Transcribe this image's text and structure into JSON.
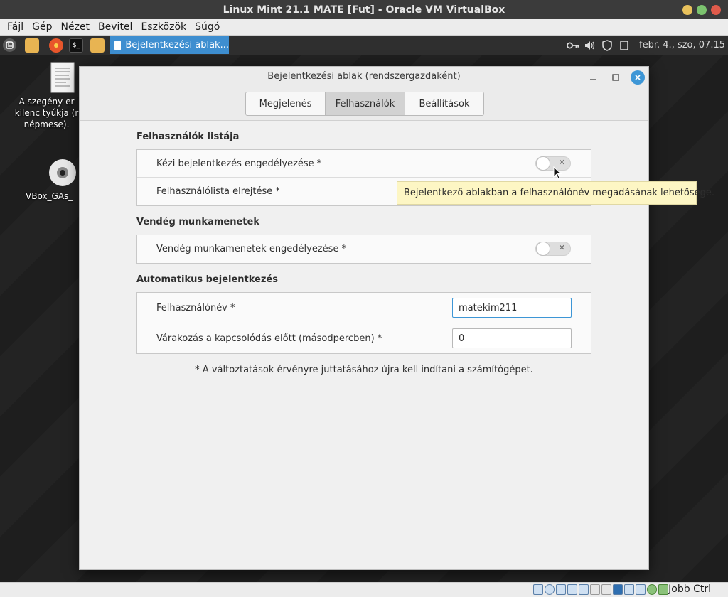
{
  "host": {
    "title": "Linux Mint 21.1 MATE [Fut] - Oracle VM VirtualBox",
    "menu": [
      "Fájl",
      "Gép",
      "Nézet",
      "Bevitel",
      "Eszközök",
      "Súgó"
    ],
    "status_text": "Jobb Ctrl",
    "window_controls": {
      "minimize_color": "#e8c15c",
      "maximize_color": "#7cc36e",
      "close_color": "#e05b4b"
    }
  },
  "panel": {
    "taskbar_label": "Bejelentkezési ablak...",
    "clock": "febr. 4., szo, 07.15",
    "launcher_icons": [
      "mint-menu-icon",
      "folder-icon",
      "firefox-icon",
      "terminal-icon",
      "files-icon"
    ],
    "tray_icons": [
      "key-icon",
      "volume-icon",
      "shield-icon",
      "clipboard-icon"
    ]
  },
  "desktop": {
    "file_icon_label_lines": [
      "A szegény er",
      "kilenc tyúkja (r",
      "népmese)."
    ],
    "cd_icon_label": "VBox_GAs_"
  },
  "dialog": {
    "title": "Bejelentkezési ablak (rendszergazdaként)",
    "tabs": [
      {
        "label": "Megjelenés",
        "active": false
      },
      {
        "label": "Felhasználók",
        "active": true
      },
      {
        "label": "Beállítások",
        "active": false
      }
    ],
    "sections": {
      "users_list": {
        "title": "Felhasználók listája",
        "manual_login_label": "Kézi bejelentkezés engedélyezése *",
        "manual_login_enabled": false,
        "hide_list_label": "Felhasználólista elrejtése *"
      },
      "guest": {
        "title": "Vendég munkamenetek",
        "guest_label": "Vendég munkamenetek engedélyezése *",
        "guest_enabled": false
      },
      "autologin": {
        "title": "Automatikus bejelentkezés",
        "username_label": "Felhasználónév *",
        "username_value": "matekim211",
        "delay_label": "Várakozás a kapcsolódás előtt (másodpercben) *",
        "delay_value": "0"
      }
    },
    "note": "* A változtatások érvényre juttatásához újra kell indítani a számítógépet.",
    "tooltip": "Bejelentkező ablakban a felhasználónév megadásának lehetősége."
  },
  "colors": {
    "accent": "#3d96d6",
    "tooltip_bg": "#fdf6c4"
  }
}
